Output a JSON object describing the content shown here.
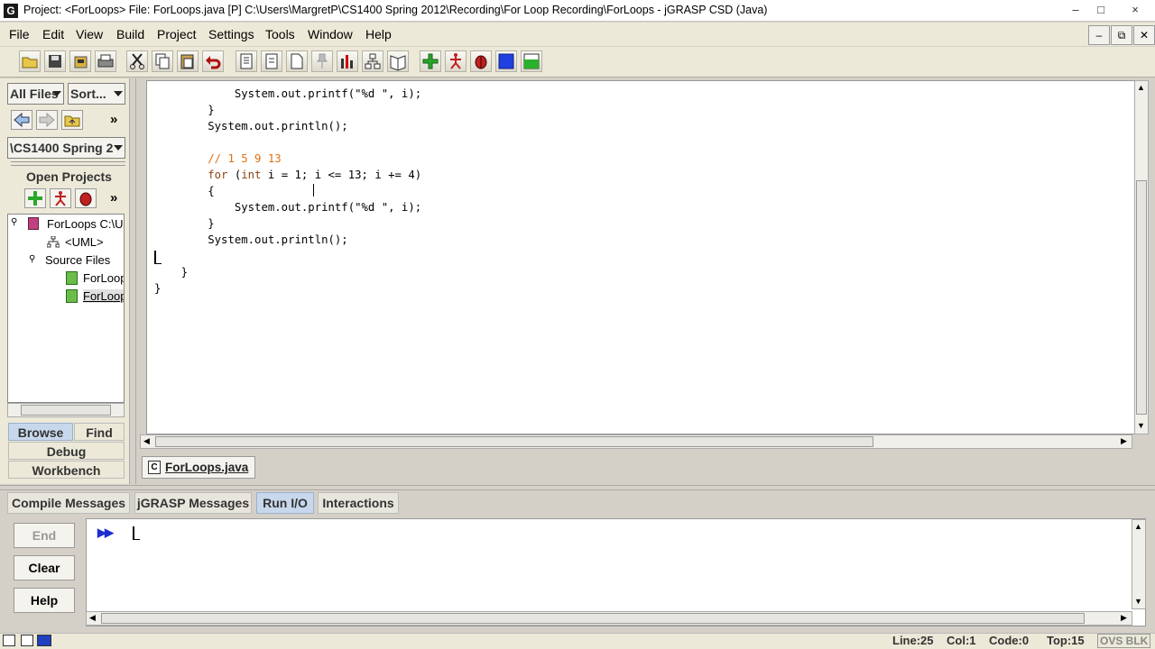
{
  "window": {
    "title": "Project: <ForLoops>    File: ForLoops.java [P]  C:\\Users\\MargretP\\CS1400 Spring 2012\\Recording\\For Loop Recording\\ForLoops - jGRASP CSD (Java)",
    "app_icon": "G",
    "controls": [
      "–",
      "□",
      "×"
    ]
  },
  "menu": [
    {
      "label": "File"
    },
    {
      "label": "Edit"
    },
    {
      "label": "View"
    },
    {
      "label": "Build"
    },
    {
      "label": "Project"
    },
    {
      "label": "Settings"
    },
    {
      "label": "Tools"
    },
    {
      "label": "Window"
    },
    {
      "label": "Help"
    }
  ],
  "mdi_controls": [
    "–",
    "⧉",
    "✕"
  ],
  "toolbar_icons": [
    "open-folder-icon",
    "save-icon",
    "save-all-icon",
    "print-icon",
    "cut-icon",
    "copy-icon",
    "paste-icon",
    "undo-icon",
    "generate-csd-icon",
    "remove-csd-icon",
    "new-file-icon",
    "pin-icon",
    "bar-chart-icon",
    "uml-icon",
    "doc-icon",
    "compile-icon",
    "run-icon",
    "debug-icon",
    "stop-icon",
    "interactions-icon"
  ],
  "left_panel": {
    "filter_combo": "All Files",
    "sort_combo": "Sort...",
    "path_combo": "\\CS1400 Spring 2",
    "open_projects_label": "Open Projects",
    "tree": {
      "project": "ForLoops  C:\\U",
      "uml": "<UML>",
      "source_files": "Source Files",
      "file1": "ForLoop",
      "file2": "ForLoop"
    },
    "tabs": {
      "browse": "Browse",
      "find": "Find",
      "debug": "Debug",
      "workbench": "Workbench"
    }
  },
  "editor": {
    "lines": [
      {
        "indent": "            ",
        "text": "System.out.printf(\"%d \", i);",
        "kind": "code"
      },
      {
        "indent": "        ",
        "text": "}",
        "kind": "code"
      },
      {
        "indent": "        ",
        "text": "System.out.println();",
        "kind": "code"
      },
      {
        "indent": "",
        "text": "",
        "kind": "code"
      },
      {
        "indent": "        ",
        "text": "// 1 5 9 13",
        "kind": "comment"
      },
      {
        "indent": "        ",
        "text": "for (int i = 1; i <= 13; i += 4)",
        "kind": "for"
      },
      {
        "indent": "        ",
        "text": "{",
        "kind": "code"
      },
      {
        "indent": "            ",
        "text": "System.out.printf(\"%d \", i);",
        "kind": "code"
      },
      {
        "indent": "        ",
        "text": "}",
        "kind": "code"
      },
      {
        "indent": "        ",
        "text": "System.out.println();",
        "kind": "code"
      },
      {
        "indent": "",
        "text": "",
        "kind": "code"
      },
      {
        "indent": "    ",
        "text": "}",
        "kind": "code"
      },
      {
        "indent": "",
        "text": "}",
        "kind": "code"
      }
    ],
    "file_tab": "ForLoops.java"
  },
  "bottom_tabs": [
    {
      "label": "Compile Messages"
    },
    {
      "label": "jGRASP Messages"
    },
    {
      "label": "Run I/O"
    },
    {
      "label": "Interactions"
    }
  ],
  "io_buttons": {
    "end": "End",
    "clear": "Clear",
    "help": "Help"
  },
  "io_prompt": "▶▶",
  "status": {
    "line": "Line:25",
    "col": "Col:1",
    "code": "Code:0",
    "top": "Top:15",
    "mode": "OVS BLK"
  }
}
